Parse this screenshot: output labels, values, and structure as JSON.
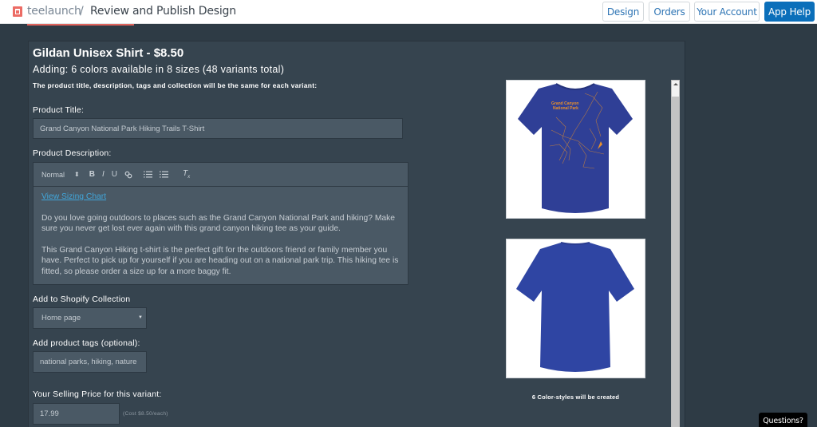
{
  "header": {
    "brand": "teelaunch",
    "separator": "/",
    "title": "Review and Publish Design",
    "nav": [
      {
        "label": "Design"
      },
      {
        "label": "Orders"
      },
      {
        "label": "Your Account"
      },
      {
        "label": "App Help"
      }
    ],
    "colors": {
      "accent": "#0b6fba",
      "brand": "#ec6c65"
    }
  },
  "product": {
    "heading": "Gildan Unisex Shirt - $8.50",
    "adding": "Adding: 6 colors available in 8 sizes (48 variants total)",
    "note": "The product title, description, tags and collection will be the same for each variant:"
  },
  "form": {
    "title_label": "Product Title:",
    "title_value": "Grand Canyon National Park Hiking Trails T-Shirt",
    "description_label": "Product Description:",
    "toolbar": {
      "format": "Normal",
      "format_caret": "⇕",
      "bold": "B",
      "italic": "I",
      "underline": "U",
      "link": "🔗",
      "ordered_list": "≡",
      "bullet_list": "≡",
      "clear_format": "Tx"
    },
    "description": {
      "link": "View Sizing Chart",
      "paragraphs": [
        "Do you love going outdoors to places such as the Grand Canyon National Park and hiking? Make sure you never get lost ever again with this grand canyon hiking tee as your guide.",
        "This Grand Canyon Hiking t-shirt is the perfect gift for the outdoors friend or family member you have. Perfect to pick up for yourself if you are heading out on a national park trip. This hiking tee is fitted, so please order a size up for a more baggy fit."
      ]
    },
    "collection_label": "Add to Shopify Collection",
    "collection_value": "Home page",
    "tags_label": "Add product tags (optional):",
    "tags_value": "national parks, hiking, nature",
    "price_label": "Your Selling Price for this variant:",
    "price_value": "17.99",
    "cost_note": "(Cost $8.50/each)"
  },
  "preview": {
    "front_print_title": "Grand Canyon National Park",
    "shirt_color": "#2f3f96",
    "print_color": "#e8902c",
    "color_styles_note": "6 Color-styles will be created"
  },
  "widget": {
    "questions": "Questions?"
  }
}
